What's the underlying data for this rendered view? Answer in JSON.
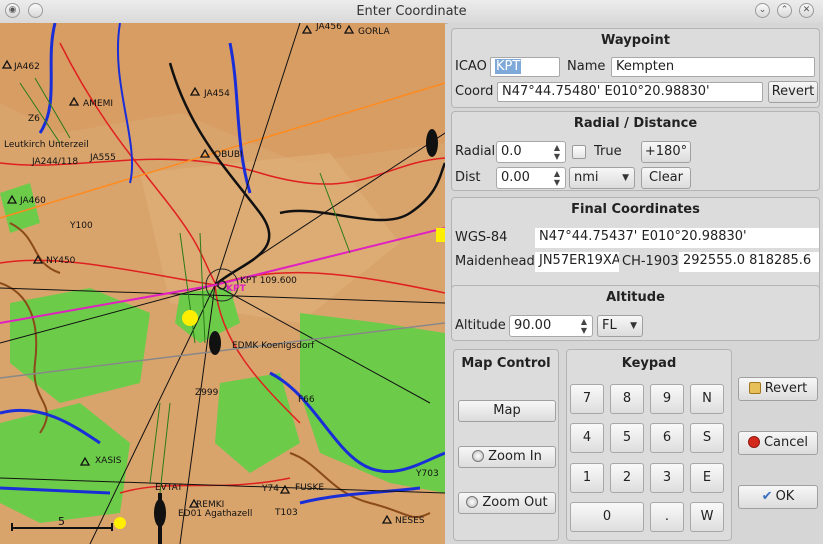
{
  "window": {
    "title": "Enter Coordinate"
  },
  "map": {
    "labels": [
      "JA456",
      "GORLA",
      "JA462",
      "AMEMI",
      "JA454",
      "Z6",
      "Leutkirch Unterzeil",
      "JA244/118",
      "JA555",
      "OBUBI",
      "JA460",
      "Y100",
      "NY450",
      "KPT 109.600",
      "EDMK Koenigsdorf",
      "Z999",
      "F66",
      "XASIS",
      "EVTAT",
      "FUSKE",
      "REMKI",
      "ED01 Agathazell",
      "Y74",
      "T103",
      "NESES",
      "Y703",
      "KPT"
    ],
    "scale_label": "5"
  },
  "waypoint": {
    "title": "Waypoint",
    "icao_label": "ICAO",
    "icao_value": "KPT",
    "name_label": "Name",
    "name_value": "Kempten",
    "coord_label": "Coord",
    "coord_value": "N47°44.75480' E010°20.98830'",
    "revert_label": "Revert"
  },
  "radial": {
    "title": "Radial / Distance",
    "radial_label": "Radial",
    "radial_value": "0.0",
    "true_label": "True",
    "true_checked": false,
    "plus180_label": "+180°",
    "dist_label": "Dist",
    "dist_value": "0.00",
    "unit_value": "nmi",
    "clear_label": "Clear"
  },
  "final": {
    "title": "Final Coordinates",
    "wgs_label": "WGS-84",
    "wgs_value": "N47°44.75437' E010°20.98830'",
    "maidenhead_label": "Maidenhead",
    "maidenhead_value": "JN57ER19XA",
    "ch_label": "CH-1903",
    "ch_value": "292555.0 818285.6"
  },
  "altitude": {
    "title": "Altitude",
    "alt_label": "Altitude",
    "alt_value": "90.00",
    "unit_value": "FL"
  },
  "map_control": {
    "title": "Map Control",
    "map_label": "Map",
    "zoom_in_label": "Zoom In",
    "zoom_out_label": "Zoom Out"
  },
  "keypad": {
    "title": "Keypad",
    "keys": [
      "7",
      "8",
      "9",
      "N",
      "4",
      "5",
      "6",
      "S",
      "1",
      "2",
      "3",
      "E",
      "0",
      ".",
      "W"
    ]
  },
  "actions": {
    "revert_label": "Revert",
    "cancel_label": "Cancel",
    "ok_label": "OK"
  },
  "colors": {
    "terrain": "#d9a36c",
    "forest": "#6ccc4a",
    "airway": "#1a2ed8",
    "route_pink": "#e020c0",
    "orange_line": "#ff8a1e",
    "red_road": "#e02020"
  }
}
